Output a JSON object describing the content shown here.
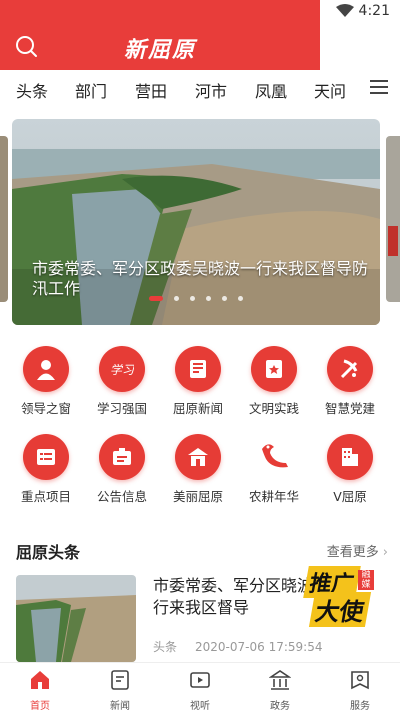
{
  "status_bar": {
    "time": "4:21"
  },
  "header": {
    "logo_text": "新屈原",
    "accent_color": "#e83d3a"
  },
  "tabs": [
    {
      "label": "头条"
    },
    {
      "label": "部门"
    },
    {
      "label": "营田"
    },
    {
      "label": "河市"
    },
    {
      "label": "凤凰"
    },
    {
      "label": "天问"
    }
  ],
  "banner": {
    "caption": "市委常委、军分区政委吴晓波一行来我区督导防汛工作",
    "slide_count": 6,
    "active_slide": 1
  },
  "grid": [
    {
      "label": "领导之窗",
      "icon": "leader-icon"
    },
    {
      "label": "学习强国",
      "icon": "study-icon"
    },
    {
      "label": "屈原新闻",
      "icon": "news-icon"
    },
    {
      "label": "文明实践",
      "icon": "civilization-icon"
    },
    {
      "label": "智慧党建",
      "icon": "party-icon"
    },
    {
      "label": "重点项目",
      "icon": "project-icon"
    },
    {
      "label": "公告信息",
      "icon": "notice-icon"
    },
    {
      "label": "美丽屈原",
      "icon": "scenery-icon"
    },
    {
      "label": "农耕年华",
      "icon": "dragon-icon"
    },
    {
      "label": "V屈原",
      "icon": "v-qu-yuan-icon"
    }
  ],
  "section": {
    "title": "屈原头条",
    "more_label": "查看更多"
  },
  "news": {
    "title": "市委常委、军分区政委吴晓波一行来我区督导防汛工作",
    "title_visible": "市委常委、军分区晓波一行来我区督导",
    "category": "头条",
    "time": "2020-07-06 17:59:54"
  },
  "promo": {
    "line1": "推广",
    "line2": "大使",
    "badge": "融媒"
  },
  "bottom_nav": [
    {
      "label": "首页",
      "icon": "home-icon",
      "active": true
    },
    {
      "label": "新闻",
      "icon": "news-tab-icon",
      "active": false
    },
    {
      "label": "视听",
      "icon": "video-icon",
      "active": false
    },
    {
      "label": "政务",
      "icon": "government-icon",
      "active": false
    },
    {
      "label": "服务",
      "icon": "service-icon",
      "active": false
    }
  ]
}
